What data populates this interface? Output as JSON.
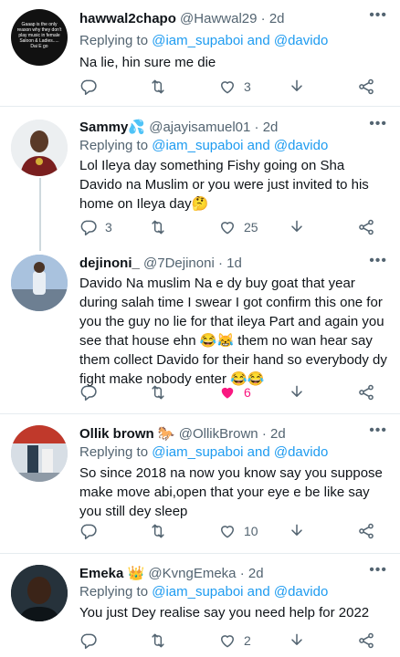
{
  "tweets": [
    {
      "name": "hawwal2chapo",
      "name_emoji": "",
      "handle": "@Hawwal29",
      "time": "2d",
      "replying_prefix": "Replying to",
      "replying_to": "@iam_supaboi and @davido",
      "text": "Na lie, hin sure me die",
      "replies": "",
      "likes": "3",
      "liked": false,
      "avatar_text": "Gaaap is the only reason why they don't play music in female Saloon & Ladies..... Dai E go"
    },
    {
      "name": "Sammy",
      "name_emoji": "💦",
      "handle": "@ajayisamuel01",
      "time": "2d",
      "replying_prefix": "Replying to",
      "replying_to": "@iam_supaboi and @davido",
      "text": "Lol Ileya day something Fishy going on Sha Davido na Muslim or you were just invited to his home on Ileya day🤔",
      "replies": "3",
      "likes": "25",
      "liked": false
    },
    {
      "name": "dejinoni_",
      "name_emoji": "",
      "handle": "@7Dejinoni",
      "time": "1d",
      "text": "Davido Na muslim Na e dy buy goat that year during salah time I swear I got confirm this one for you the guy no lie for that ileya Part and again you see that house ehn 😂😹 them no wan hear say them collect Davido for their hand so everybody dy fight make nobody enter 😂😂",
      "replies": "",
      "likes": "6",
      "liked": true
    },
    {
      "name": "Ollik brown",
      "name_emoji": "🐎",
      "handle": "@OllikBrown",
      "time": "2d",
      "replying_prefix": "Replying to",
      "replying_to": "@iam_supaboi and @davido",
      "text": "So since 2018 na now you know say you suppose make move abi,open that your eye e be like say you still dey sleep",
      "replies": "",
      "likes": "10",
      "liked": false
    },
    {
      "name": "Emeka",
      "name_emoji": "👑",
      "handle": "@KvngEmeka",
      "time": "2d",
      "replying_prefix": "Replying to",
      "replying_to": "@iam_supaboi and @davido",
      "text": "You just Dey realise say you need help for 2022",
      "replies": "",
      "likes": "2",
      "liked": false
    }
  ],
  "icons": {
    "reply": "reply-icon",
    "retweet": "retweet-icon",
    "like": "like-icon",
    "download": "download-icon",
    "share": "share-icon",
    "more": "more-icon"
  },
  "colors": {
    "link": "#1d9bf0",
    "muted": "#536471",
    "like_active": "#f91880",
    "divider": "#e6ecf0"
  }
}
